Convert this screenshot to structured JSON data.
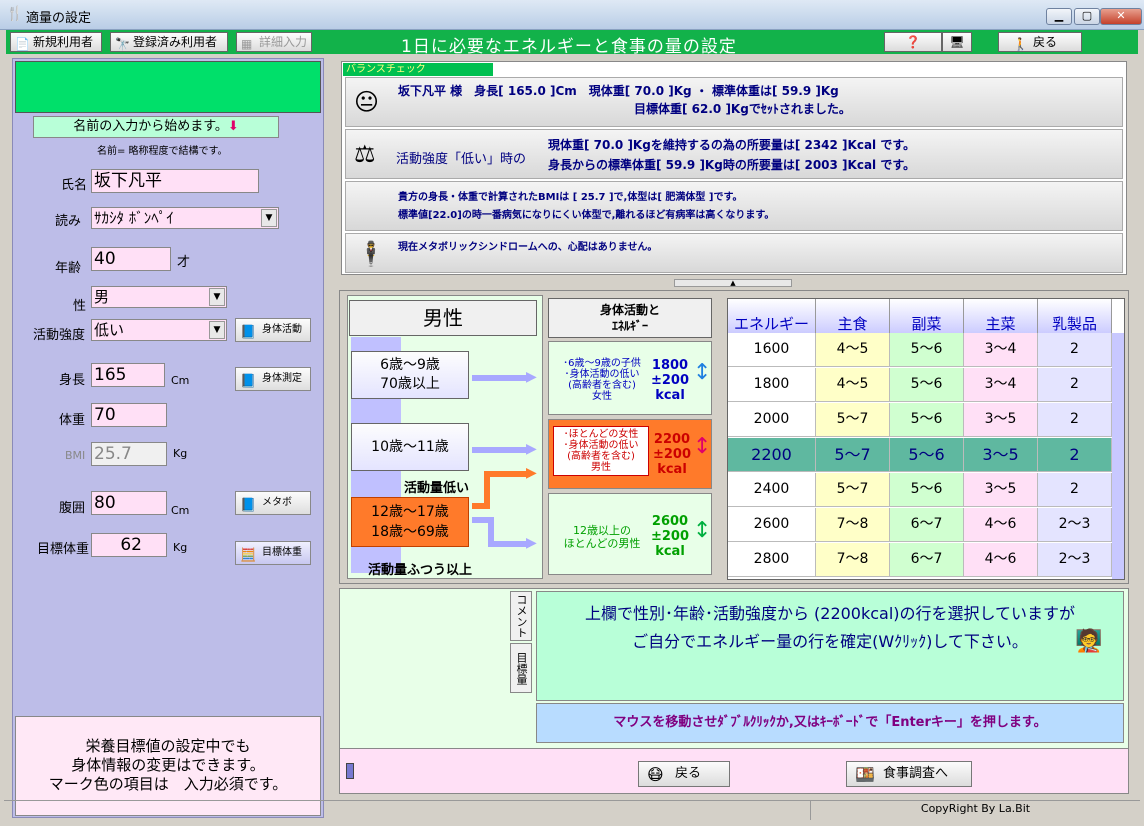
{
  "window": {
    "title": "適量の設定"
  },
  "toolbar": {
    "new_user": "新規利用者",
    "registered": "登録済み利用者",
    "detail": "詳細入力",
    "heading": "1日に必要なエネルギーと食事の量の設定",
    "back": "戻る"
  },
  "left": {
    "start_btn": "名前の入力から始めます。",
    "hint": "名前= 略称程度で結構です。",
    "name_label": "氏名",
    "name_value": "坂下凡平",
    "reading_label": "読み",
    "reading_value": "ｻｶｼﾀ ﾎﾞﾝﾍﾟｲ",
    "age_label": "年齢",
    "age_value": "40",
    "age_unit": "才",
    "sex_label": "性",
    "sex_value": "男",
    "activity_label": "活動強度",
    "activity_value": "低い",
    "activity_btn": "身体活動",
    "height_label": "身長",
    "height_value": "165",
    "height_unit": "Cm",
    "height_btn": "身体測定",
    "weight_label": "体重",
    "weight_value": "70",
    "bmi_label": "BMI",
    "bmi_value": "25.7",
    "bmi_unit": "Kg",
    "waist_label": "腹囲",
    "waist_value": "80",
    "waist_unit": "Cm",
    "waist_btn": "メタボ",
    "target_label": "目標体重",
    "target_value": "62",
    "target_unit": "Kg",
    "target_btn": "目標体重",
    "bottom1": "栄養目標値の設定中でも",
    "bottom2": "身体情報の変更はできます。",
    "bottom3": "マーク色の項目は　入力必須です。"
  },
  "balance": {
    "label": "バランスチェック",
    "r1a": "坂下凡平 様　身長[ 165.0 ]Cm　現体重[ 70.0 ]Kg ・ 標準体重は[ 59.9 ]Kg",
    "r1b": "目標体重[ 62.0 ]Kgでｾｯﾄされました。",
    "r2label": "活動強度「低い」時の",
    "r2a": "現体重[ 70.0 ]Kgを維持するの為の所要量は[ 2342 ]Kcal です。",
    "r2b": "身長からの標準体重[ 59.9 ]Kg時の所要量は[ 2003 ]Kcal です。",
    "r3a": "貴方の身長・体重で計算されたBMIは [ 25.7 ]で,体型は[ 肥満体型 ]です。",
    "r3b": "標準値[22.0]の時一番病気になりにくい体型で,離れるほど有病率は高くなります。",
    "r4": "現在メタボリックシンドロームへの、心配はありません。"
  },
  "mid": {
    "male": "男性",
    "act_title1": "身体活動と",
    "act_title2": "ｴﾈﾙｷﾞｰ",
    "age1a": "6歳～9歳",
    "age1b": "70歳以上",
    "age2": "10歳～11歳",
    "age3a": "12歳～17歳",
    "age3b": "18歳～69歳",
    "low": "活動量低い",
    "normal": "活動量ふつう以上",
    "e1a": "･6歳～9歳の子供",
    "e1b": "･身体活動の低い",
    "e1c": "(高齢者を含む)",
    "e1d": "女性",
    "e1n1": "1800",
    "e1n2": "±200",
    "e1n3": "kcal",
    "e2a": "･ほとんどの女性",
    "e2b": "･身体活動の低い",
    "e2c": "(高齢者を含む)",
    "e2d": "男性",
    "e2n1": "2200",
    "e2n2": "±200",
    "e2n3": "kcal",
    "e3a": "12歳以上の",
    "e3b": "ほとんどの男性",
    "e3n1": "2600",
    "e3n2": "±200",
    "e3n3": "kcal"
  },
  "table": {
    "headers": [
      "エネルギー",
      "主食",
      "副菜",
      "主菜",
      "乳製品"
    ],
    "rows": [
      [
        "1600",
        "4～5",
        "5～6",
        "3～4",
        "2"
      ],
      [
        "1800",
        "4～5",
        "5～6",
        "3～4",
        "2"
      ],
      [
        "2000",
        "5～7",
        "5～6",
        "3～5",
        "2"
      ],
      [
        "2200",
        "5～7",
        "5～6",
        "3～5",
        "2"
      ],
      [
        "2400",
        "5～7",
        "5～6",
        "3～5",
        "2"
      ],
      [
        "2600",
        "7～8",
        "6～7",
        "4～6",
        "2～3"
      ],
      [
        "2800",
        "7～8",
        "6～7",
        "4～6",
        "2～3"
      ]
    ]
  },
  "comment": {
    "tab1": "コメント",
    "tab2": "目標量",
    "line1": "上欄で性別･年齢･活動強度から (2200kcal)の行を選択していますが",
    "line2": "ご自分でエネルギー量の行を確定(Wｸﾘｯｸ)して下さい。",
    "mouse": "マウスを移動させﾀﾞﾌﾞﾙｸﾘｯｸか,又はｷｰﾎﾞｰﾄﾞで「Enterキー」を押します。"
  },
  "bottom": {
    "back": "戻る",
    "survey": "食事調査へ"
  },
  "status": {
    "copyright": "CopyRight By La.Bit"
  }
}
